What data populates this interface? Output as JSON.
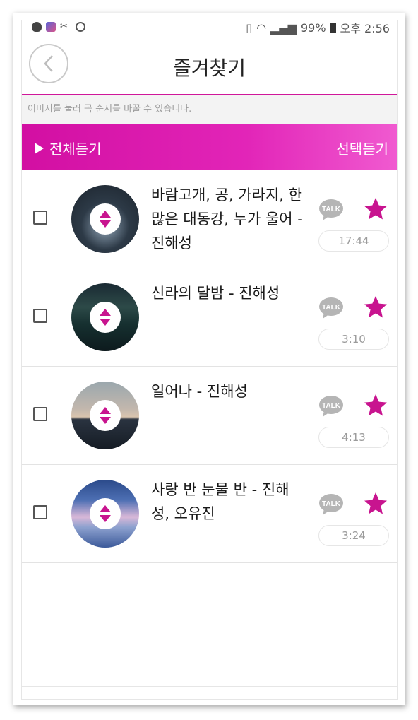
{
  "status_bar": {
    "battery": "99%",
    "time": "오후 2:56"
  },
  "header": {
    "title": "즐겨찾기"
  },
  "hint": "이미지를 눌러 곡 순서를 바꿀 수 있습니다.",
  "actions": {
    "play_all": "전체듣기",
    "play_selected": "선택듣기"
  },
  "songs": [
    {
      "title": "바람고개, 공, 가라지, 한 많은 대동강, 누가 울어 - 진해성",
      "duration": "17:44",
      "talk_label": "TALK"
    },
    {
      "title": "신라의 달밤 - 진해성",
      "duration": "3:10",
      "talk_label": "TALK"
    },
    {
      "title": "일어나 - 진해성",
      "duration": "4:13",
      "talk_label": "TALK"
    },
    {
      "title": "사랑 반 눈물 반 - 진해성, 오유진",
      "duration": "3:24",
      "talk_label": "TALK"
    }
  ],
  "colors": {
    "accent": "#d20fa2",
    "star": "#c8148f"
  }
}
